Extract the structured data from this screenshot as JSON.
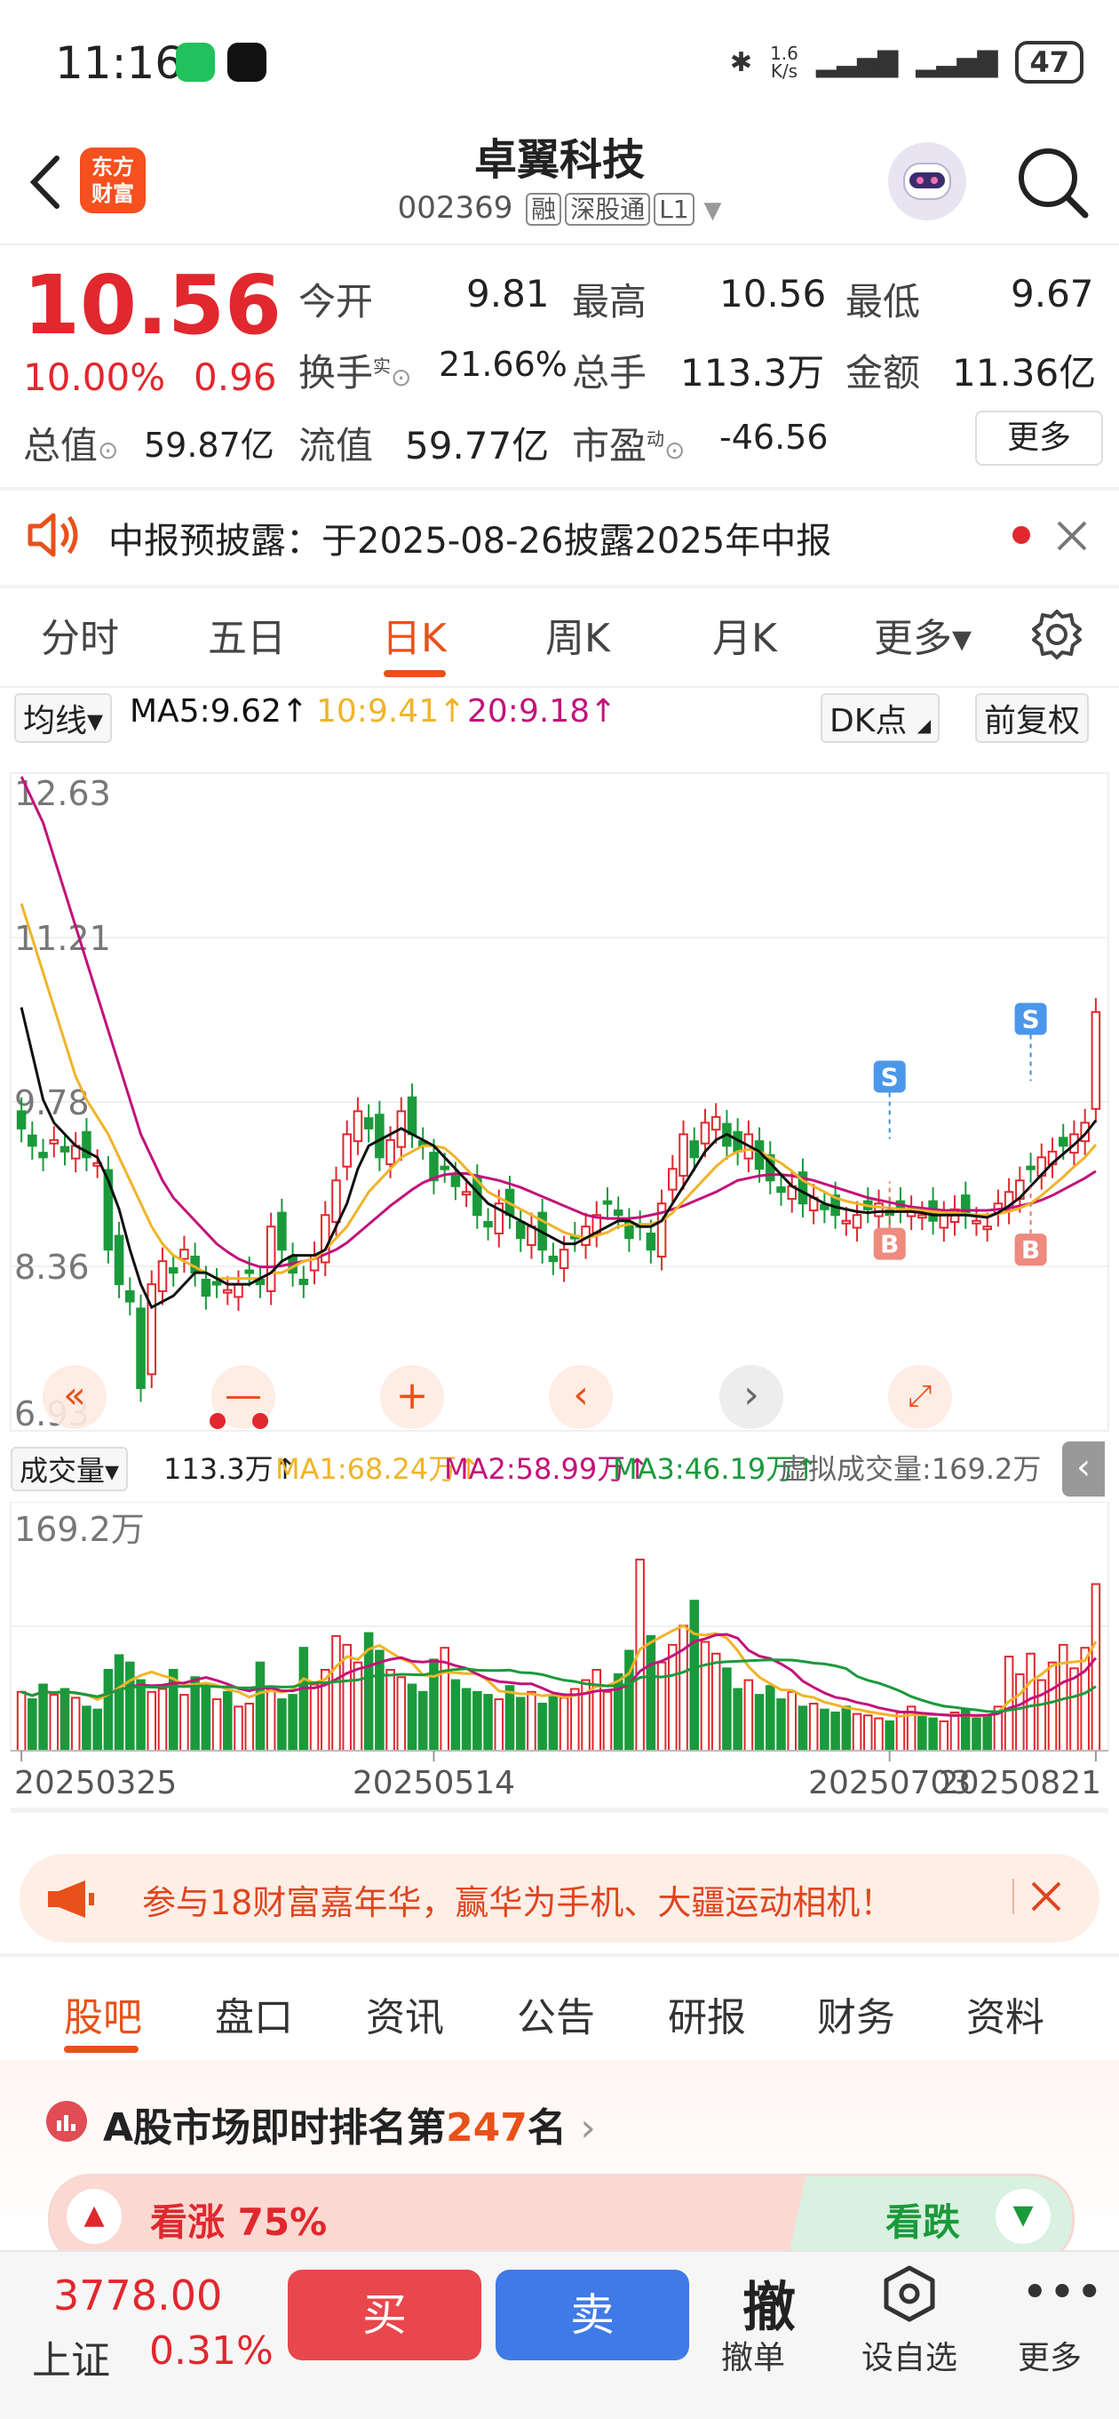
{
  "status_bar": {
    "time": "11:16",
    "net_speed_top": "1.6",
    "net_speed_bottom": "K/s",
    "battery": "47"
  },
  "header": {
    "title": "卓翼科技",
    "code": "002369",
    "tags": [
      "融",
      "深股通",
      "L1"
    ],
    "logo_lines": [
      "东方",
      "财富"
    ]
  },
  "quote": {
    "price": "10.56",
    "change_pct": "10.00%",
    "change": "0.96",
    "open_label": "今开",
    "open": "9.81",
    "high_label": "最高",
    "high": "10.56",
    "low_label": "最低",
    "low": "9.67",
    "turnover_label": "换手",
    "turnover_sup": "实",
    "turnover": "21.66%",
    "volume_label": "总手",
    "volume": "113.3万",
    "amount_label": "金额",
    "amount": "11.36亿",
    "mktcap_label": "总值",
    "mktcap": "59.87亿",
    "float_label": "流值",
    "float_cap": "59.77亿",
    "pe_label": "市盈",
    "pe_sup": "动",
    "pe": "-46.56",
    "more": "更多"
  },
  "notice": {
    "text": "中报预披露：于2025-08-26披露2025年中报"
  },
  "period_tabs": [
    "分时",
    "五日",
    "日K",
    "周K",
    "月K",
    "更多▾"
  ],
  "chart_header": {
    "indicator": "均线▾",
    "ma5": "MA5:9.62↑",
    "ma10": "10:9.41↑",
    "ma20": "20:9.18↑",
    "dk": "DK点",
    "adjust": "前复权"
  },
  "chart_data": [
    {
      "type": "candlestick",
      "y_ticks": [
        "12.63",
        "11.21",
        "9.78",
        "8.36",
        "6.93"
      ],
      "ylim": [
        6.93,
        12.63
      ],
      "x_ticks": [
        "20250325",
        "20250514",
        "20250703",
        "20250821"
      ],
      "signals": [
        "S",
        "B",
        "S",
        "B"
      ],
      "close": [
        9.55,
        9.4,
        9.3,
        9.45,
        9.35,
        9.4,
        9.3,
        9.25,
        8.5,
        8.2,
        8.05,
        7.3,
        8.2,
        8.4,
        8.3,
        8.5,
        8.3,
        8.1,
        8.2,
        8.15,
        8.2,
        8.3,
        8.2,
        8.7,
        8.5,
        8.3,
        8.2,
        8.45,
        8.8,
        9.1,
        9.5,
        9.7,
        9.55,
        9.3,
        9.45,
        9.7,
        9.5,
        9.4,
        9.1,
        9.2,
        9.05,
        9.0,
        8.8,
        8.7,
        8.9,
        8.8,
        8.6,
        8.7,
        8.5,
        8.4,
        8.5,
        8.6,
        8.7,
        8.8,
        8.9,
        8.8,
        8.6,
        8.7,
        8.5,
        8.9,
        9.2,
        9.5,
        9.3,
        9.6,
        9.65,
        9.4,
        9.35,
        9.5,
        9.2,
        9.1,
        9.0,
        9.05,
        8.9,
        8.95,
        8.85,
        8.8,
        8.75,
        8.8,
        8.85,
        8.9,
        8.8,
        8.85,
        8.85,
        8.8,
        8.75,
        8.8,
        8.85,
        8.8,
        8.75,
        8.7,
        8.9,
        9.0,
        9.1,
        9.2,
        9.3,
        9.35,
        9.4,
        9.5,
        9.6,
        10.56
      ],
      "ma5": [
        10.6,
        10.2,
        9.8,
        9.6,
        9.5,
        9.4,
        9.35,
        9.3,
        9.1,
        8.85,
        8.5,
        8.2,
        8.0,
        8.05,
        8.1,
        8.2,
        8.3,
        8.3,
        8.25,
        8.2,
        8.2,
        8.2,
        8.25,
        8.3,
        8.4,
        8.45,
        8.45,
        8.45,
        8.5,
        8.7,
        8.9,
        9.2,
        9.4,
        9.45,
        9.5,
        9.55,
        9.5,
        9.45,
        9.4,
        9.3,
        9.2,
        9.1,
        9.0,
        8.9,
        8.85,
        8.8,
        8.75,
        8.7,
        8.65,
        8.6,
        8.55,
        8.55,
        8.6,
        8.65,
        8.7,
        8.75,
        8.75,
        8.7,
        8.7,
        8.75,
        8.9,
        9.05,
        9.2,
        9.35,
        9.45,
        9.5,
        9.45,
        9.4,
        9.35,
        9.25,
        9.15,
        9.05,
        9.0,
        8.95,
        8.9,
        8.87,
        8.85,
        8.83,
        8.82,
        8.83,
        8.83,
        8.83,
        8.83,
        8.82,
        8.8,
        8.8,
        8.8,
        8.8,
        8.79,
        8.78,
        8.82,
        8.88,
        8.95,
        9.05,
        9.15,
        9.25,
        9.33,
        9.41,
        9.5,
        9.62
      ],
      "ma10": [
        11.5,
        11.2,
        10.9,
        10.6,
        10.3,
        10.0,
        9.8,
        9.65,
        9.5,
        9.3,
        9.1,
        8.9,
        8.7,
        8.55,
        8.45,
        8.4,
        8.35,
        8.3,
        8.25,
        8.25,
        8.25,
        8.25,
        8.25,
        8.3,
        8.3,
        8.35,
        8.4,
        8.42,
        8.5,
        8.6,
        8.7,
        8.85,
        9.0,
        9.1,
        9.2,
        9.3,
        9.35,
        9.4,
        9.4,
        9.38,
        9.3,
        9.2,
        9.1,
        9.0,
        8.95,
        8.9,
        8.85,
        8.8,
        8.75,
        8.7,
        8.65,
        8.62,
        8.6,
        8.62,
        8.65,
        8.7,
        8.72,
        8.72,
        8.72,
        8.75,
        8.82,
        8.92,
        9.02,
        9.12,
        9.22,
        9.3,
        9.35,
        9.37,
        9.35,
        9.3,
        9.25,
        9.18,
        9.1,
        9.05,
        9.0,
        8.95,
        8.92,
        8.9,
        8.88,
        8.87,
        8.86,
        8.85,
        8.85,
        8.84,
        8.83,
        8.82,
        8.82,
        8.81,
        8.8,
        8.8,
        8.81,
        8.83,
        8.86,
        8.9,
        8.97,
        9.05,
        9.13,
        9.22,
        9.3,
        9.41
      ],
      "ma20": [
        12.6,
        12.4,
        12.2,
        11.9,
        11.6,
        11.3,
        11.0,
        10.7,
        10.4,
        10.1,
        9.8,
        9.5,
        9.3,
        9.1,
        8.95,
        8.85,
        8.75,
        8.65,
        8.55,
        8.48,
        8.42,
        8.38,
        8.35,
        8.35,
        8.36,
        8.38,
        8.4,
        8.42,
        8.46,
        8.5,
        8.56,
        8.64,
        8.72,
        8.8,
        8.88,
        8.95,
        9.02,
        9.08,
        9.12,
        9.15,
        9.16,
        9.16,
        9.14,
        9.12,
        9.1,
        9.07,
        9.04,
        9.0,
        8.96,
        8.92,
        8.88,
        8.84,
        8.8,
        8.78,
        8.77,
        8.77,
        8.77,
        8.78,
        8.8,
        8.82,
        8.85,
        8.88,
        8.92,
        8.96,
        9.0,
        9.05,
        9.1,
        9.12,
        9.14,
        9.15,
        9.15,
        9.14,
        9.12,
        9.1,
        9.07,
        9.04,
        9.01,
        8.98,
        8.95,
        8.93,
        8.91,
        8.89,
        8.87,
        8.86,
        8.85,
        8.84,
        8.84,
        8.84,
        8.84,
        8.84,
        8.85,
        8.86,
        8.88,
        8.9,
        8.93,
        8.97,
        9.02,
        9.07,
        9.12,
        9.18
      ]
    },
    {
      "type": "bar",
      "title": "成交量",
      "y_ticks": [
        "169.2万"
      ],
      "ylim": [
        0,
        169.2
      ],
      "volume": [
        40,
        35,
        45,
        38,
        42,
        36,
        30,
        28,
        55,
        65,
        60,
        48,
        40,
        42,
        55,
        38,
        50,
        45,
        35,
        40,
        30,
        32,
        60,
        42,
        35,
        38,
        70,
        45,
        55,
        78,
        72,
        60,
        80,
        68,
        55,
        50,
        45,
        40,
        62,
        70,
        48,
        42,
        40,
        38,
        35,
        44,
        36,
        40,
        32,
        38,
        36,
        42,
        48,
        55,
        40,
        52,
        68,
        130,
        78,
        60,
        72,
        85,
        102,
        74,
        66,
        56,
        42,
        48,
        38,
        44,
        35,
        40,
        30,
        32,
        28,
        26,
        30,
        25,
        24,
        22,
        20,
        26,
        30,
        24,
        22,
        20,
        26,
        28,
        22,
        24,
        30,
        64,
        52,
        66,
        48,
        60,
        72,
        56,
        70,
        113.3
      ]
    }
  ],
  "volume_header": {
    "indicator": "成交量▾",
    "vol": "113.3万↑",
    "ma1": "MA1:68.24万↑",
    "ma2": "MA2:58.99万↑",
    "ma3": "MA3:46.19万↑",
    "virtual": "虚拟成交量:169.2万"
  },
  "banner": {
    "text": "参与18财富嘉年华，赢华为手机、大疆运动相机！"
  },
  "bottom_tabs": [
    "股吧",
    "盘口",
    "资讯",
    "公告",
    "研报",
    "财务",
    "资料"
  ],
  "rank": {
    "prefix": "A股市场即时排名第",
    "number": "247",
    "suffix": "名"
  },
  "vote": {
    "up": "看涨 75%",
    "down": "看跌"
  },
  "index": {
    "value": "3778.00",
    "name": "上证",
    "change": "0.31%"
  },
  "actions": {
    "buy": "买",
    "sell": "卖",
    "cancel": "撤",
    "cancel_label": "撤单",
    "watch_label": "设自选",
    "more_label": "更多"
  },
  "colors": {
    "up": "#e0282e",
    "down": "#1a9a3b",
    "accent": "#e8511a",
    "ma5": "#111111",
    "ma10": "#f0b429",
    "ma20": "#c3127a"
  }
}
